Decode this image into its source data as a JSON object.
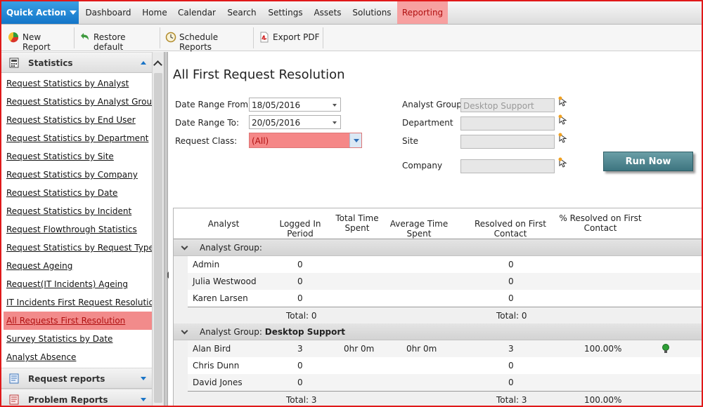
{
  "nav": {
    "quick_action": "Quick Action",
    "items": [
      "Dashboard",
      "Home",
      "Calendar",
      "Search",
      "Settings",
      "Assets",
      "Solutions",
      "Reporting"
    ],
    "active": "Reporting"
  },
  "toolbar": {
    "new_report": "New Report",
    "restore_default": "Restore default",
    "schedule_reports": "Schedule Reports",
    "export_pdf": "Export PDF"
  },
  "sidebar": {
    "section_statistics": "Statistics",
    "links": [
      "Request Statistics by Analyst",
      "Request Statistics by Analyst Group",
      "Request Statistics by End User",
      "Request Statistics by Department",
      "Request Statistics by Site",
      "Request Statistics by Company",
      "Request Statistics by Date",
      "Request Statistics by Incident",
      "Request Flowthrough Statistics",
      "Request Statistics by Request Type",
      "Request Ageing",
      "Request(IT Incidents) Ageing",
      "IT Incidents First Request Resolution",
      "All Requests First Resolution",
      "Survey Statistics by Date",
      "Analyst Absence"
    ],
    "active_link": "All Requests First Resolution",
    "section_request_reports": "Request reports",
    "section_problem_reports": "Problem Reports"
  },
  "main": {
    "title": "All First Request Resolution",
    "filters": {
      "date_from_label": "Date Range From:",
      "date_from_value": "18/05/2016",
      "date_to_label": "Date Range To:",
      "date_to_value": "20/05/2016",
      "request_class_label": "Request Class:",
      "request_class_value": "(All)",
      "analyst_group_label": "Analyst Group",
      "analyst_group_value": "Desktop Support",
      "department_label": "Department",
      "department_value": "",
      "site_label": "Site",
      "site_value": "",
      "company_label": "Company",
      "company_value": ""
    },
    "run_now": "Run Now"
  },
  "grid": {
    "columns": [
      "Analyst",
      "Logged In Period",
      "Total Time Spent",
      "Average Time Spent",
      "Resolved on First Contact",
      "% Resolved on First Contact"
    ],
    "groups": [
      {
        "label": "Analyst Group:",
        "value": "",
        "rows": [
          {
            "analyst": "Admin",
            "logged": "0",
            "total_time": "",
            "avg_time": "",
            "resolved": "0",
            "pct": "",
            "indicator": false
          },
          {
            "analyst": "Julia Westwood",
            "logged": "0",
            "total_time": "",
            "avg_time": "",
            "resolved": "0",
            "pct": "",
            "indicator": false
          },
          {
            "analyst": "Karen Larsen",
            "logged": "0",
            "total_time": "",
            "avg_time": "",
            "resolved": "0",
            "pct": "",
            "indicator": false
          }
        ],
        "total_logged": "Total: 0",
        "total_resolved": "Total: 0",
        "total_pct": ""
      },
      {
        "label": "Analyst Group:",
        "value": "Desktop Support",
        "rows": [
          {
            "analyst": "Alan Bird",
            "logged": "3",
            "total_time": "0hr 0m",
            "avg_time": "0hr 0m",
            "resolved": "3",
            "pct": "100.00%",
            "indicator": true
          },
          {
            "analyst": "Chris Dunn",
            "logged": "0",
            "total_time": "",
            "avg_time": "",
            "resolved": "0",
            "pct": "",
            "indicator": false
          },
          {
            "analyst": "David Jones",
            "logged": "0",
            "total_time": "",
            "avg_time": "",
            "resolved": "0",
            "pct": "",
            "indicator": false
          }
        ],
        "total_logged": "Total: 3",
        "total_resolved": "Total: 3",
        "total_pct": "100.00%"
      }
    ]
  }
}
